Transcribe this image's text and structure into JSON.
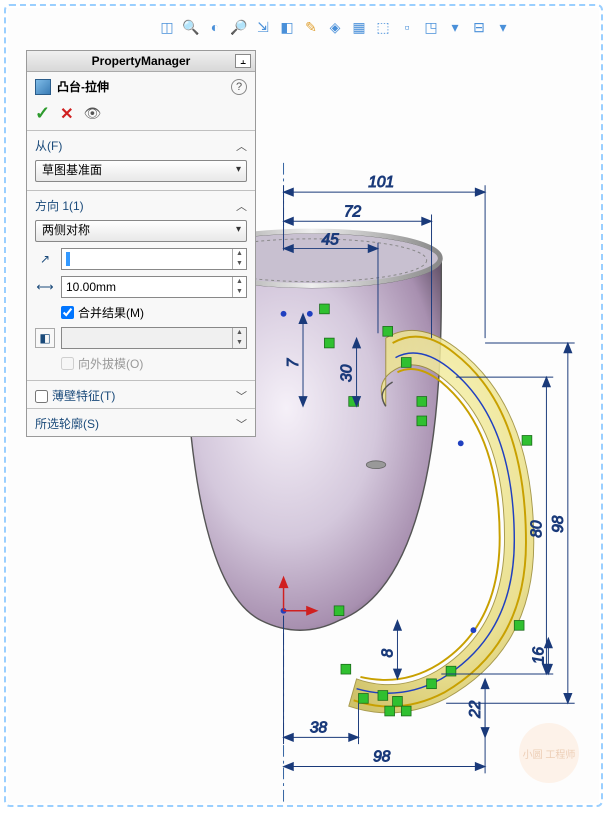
{
  "panel": {
    "title": "PropertyManager",
    "feature_name": "凸台-拉伸",
    "sections": {
      "from": {
        "label": "从(F)",
        "combo": "草图基准面"
      },
      "dir1": {
        "label": "方向 1(1)",
        "end_condition": "两侧对称",
        "distance": "10.00mm",
        "depth_input_selected": " ",
        "merge": "合并结果(M)",
        "draft_outward": "向外拔模(O)"
      },
      "thin": {
        "label": "薄壁特征(T)"
      },
      "contours": {
        "label": "所选轮廓(S)"
      }
    }
  },
  "dimensions": {
    "top_101": "101",
    "top_72": "72",
    "top_45": "45",
    "left_7": "7",
    "left_30": "30",
    "right_98": "98",
    "right_80": "80",
    "right_16": "16",
    "bottom_8": "8",
    "bottom_22": "22",
    "bottom_38": "38",
    "bottom_98": "98"
  },
  "watermark": "小圆\n工程师"
}
